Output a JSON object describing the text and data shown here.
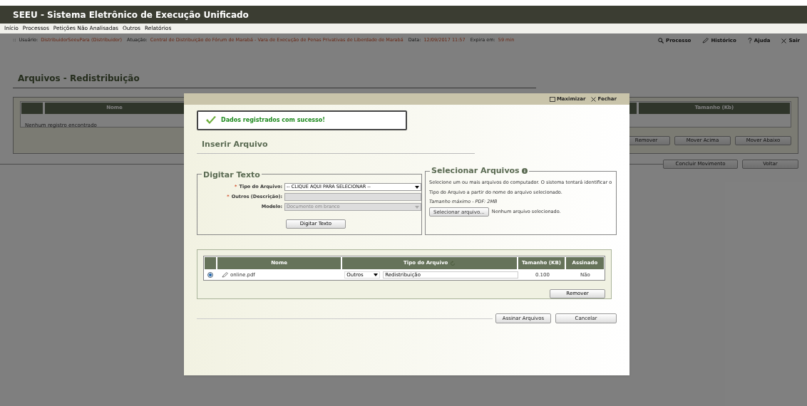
{
  "app_title": "SEEU - Sistema Eletrônico de Execução Unificado",
  "menu": [
    "Início",
    "Processos",
    "Petições Não Analisadas",
    "Outros",
    "Relatórios"
  ],
  "session_prefix": "::",
  "session_info": [
    {
      "label": "Usuário:",
      "value": "DistribuidorSeeuPara (Distribuidor)"
    },
    {
      "label": "Atuação:",
      "value": "Central de Distribuição do Fórum de Marabá - Vara de Execução de Penas Privativas de Liberdade de Marabá"
    },
    {
      "label": "Data:",
      "value": "12/09/2017 11:57"
    },
    {
      "label": "Expira em:",
      "value": "59 min"
    }
  ],
  "top_links": [
    {
      "kind": "search",
      "label": "Processo"
    },
    {
      "kind": "history",
      "label": "Histórico"
    },
    {
      "kind": "help",
      "label": "Ajuda"
    },
    {
      "kind": "exit",
      "label": "Sair"
    }
  ],
  "page_title": "Arquivos - Redistribuição",
  "background_table": {
    "columns": [
      "Nome",
      "Tamanho (Kb)"
    ],
    "empty_message": "Nenhum registro encontrado"
  },
  "background_buttons": [
    "Remover",
    "Mover Acima",
    "Mover Abaixo"
  ],
  "footer_buttons": [
    "Concluir Movimento",
    "Voltar"
  ],
  "modal": {
    "header_actions": [
      {
        "kind": "maximize",
        "label": "Maximizar"
      },
      {
        "kind": "close",
        "label": "Fechar"
      }
    ],
    "success_message": "Dados registrados com sucesso!",
    "section_title": "Inserir Arquivo",
    "digitar_texto": {
      "legend": "Digitar Texto",
      "fields": [
        {
          "label": "Tipo do Arquivo:",
          "required_mark": "*",
          "kind": "select",
          "value": "-- CLIQUE AQUI PARA SELECIONAR --",
          "disabled": false
        },
        {
          "label": "Outros (Descrição):",
          "required_mark": "*",
          "kind": "input",
          "disabled": true
        },
        {
          "label": "Modelo:",
          "kind": "select",
          "value": "Documento em branco",
          "disabled": true
        }
      ],
      "button": "Digitar Texto"
    },
    "selecionar_arquivos": {
      "legend": "Selecionar Arquivos",
      "description": "Selecione um ou mais arquivos do computador. O sistema tentará identificar o Tipo do Arquivo a partir do nome do arquivo selecionado.",
      "limit_note": "Tamanho máximo - PDF: 2MB",
      "file_button": "Selecionar arquivo...",
      "file_status": "Nenhum arquivo selecionado."
    },
    "files_table": {
      "columns": [
        "Nome",
        "Tipo do Arquivo",
        "Tamanho (KB)",
        "Assinado"
      ],
      "rows": [
        {
          "selected": true,
          "name": "online.pdf",
          "type": "Outros",
          "description": "Redistribuição",
          "size": "0.100",
          "signed": "Não"
        }
      ],
      "remove_button": "Remover"
    },
    "actions": [
      "Assinar Arquivos",
      "Cancelar"
    ]
  }
}
